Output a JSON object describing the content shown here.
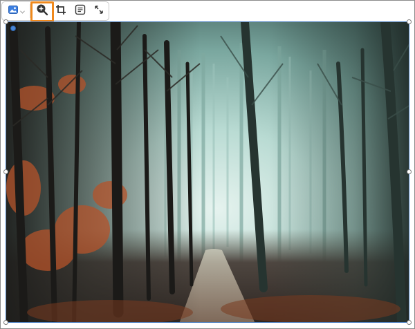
{
  "toolbar": {
    "buttons": [
      {
        "name": "image-type-dropdown",
        "icon": "image-icon"
      },
      {
        "name": "zoom-in",
        "icon": "zoom-in-icon"
      },
      {
        "name": "crop",
        "icon": "crop-icon"
      },
      {
        "name": "alt-text",
        "icon": "text-box-icon"
      },
      {
        "name": "resize",
        "icon": "expand-icon"
      }
    ],
    "highlight_color": "#f0891c",
    "icon_color": "#333333"
  },
  "image": {
    "subject": "foggy-forest-path",
    "selection_color": "#4a7fc1"
  }
}
